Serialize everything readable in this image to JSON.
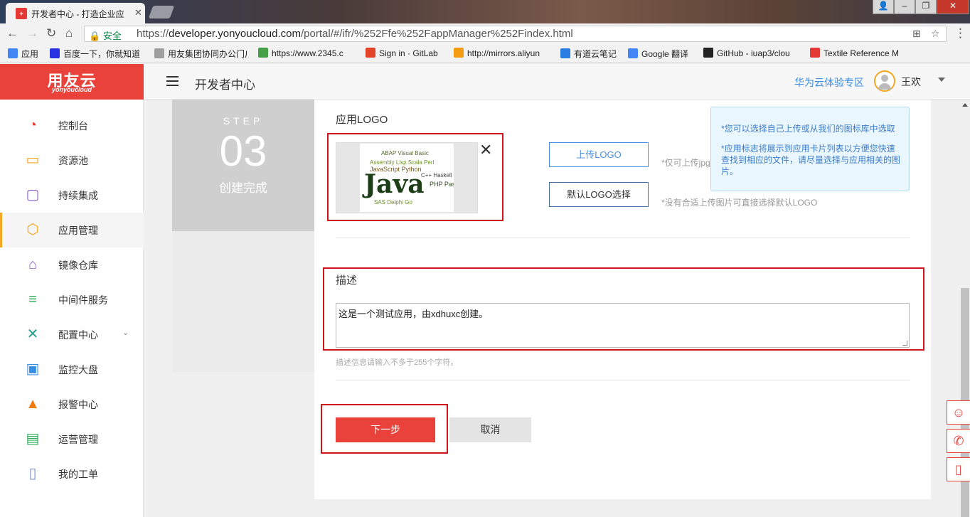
{
  "browser": {
    "tab_title": "开发者中心 - 打造企业应",
    "tab_favicon": "yonyou-favicon",
    "secure_label": "安全",
    "url_prefix": "https://",
    "url_host": "developer.yonyoucloud.com",
    "url_path": "/portal/#/ifr/%252Ffe%252FappManager%252Findex.html",
    "bookmarks": [
      {
        "label": "应用",
        "icon": "apps-grid-icon",
        "color": "#4285f4"
      },
      {
        "label": "百度一下，你就知道",
        "icon": "baidu-paw-icon",
        "color": "#2932e1"
      },
      {
        "label": "用友集团协同办公门户",
        "icon": "page-icon",
        "color": "#9e9e9e"
      },
      {
        "label": "https://www.2345.c",
        "icon": "2345-icon",
        "color": "#43a047"
      },
      {
        "label": "Sign in · GitLab",
        "icon": "gitlab-icon",
        "color": "#e24329"
      },
      {
        "label": "http://mirrors.aliyun",
        "icon": "aliyun-icon",
        "color": "#f39c12"
      },
      {
        "label": "有道云笔记",
        "icon": "youdao-note-icon",
        "color": "#2a7de1"
      },
      {
        "label": "Google 翻译",
        "icon": "google-translate-icon",
        "color": "#4285f4"
      },
      {
        "label": "GitHub - iuap3/clou",
        "icon": "github-icon",
        "color": "#222222"
      },
      {
        "label": "Textile Reference M",
        "icon": "textile-icon",
        "color": "#e53935"
      }
    ]
  },
  "header": {
    "logo_main": "用友云",
    "logo_sub": "yonyoucloud",
    "title": "开发者中心",
    "zone_link": "华为云体验专区",
    "user_name": "王欢"
  },
  "sidebar": {
    "items": [
      {
        "label": "控制台",
        "icon": "dashboard-icon",
        "color": "#e8423a"
      },
      {
        "label": "资源池",
        "icon": "inbox-icon",
        "color": "#f5a623"
      },
      {
        "label": "持续集成",
        "icon": "integration-icon",
        "color": "#8e5cc7"
      },
      {
        "label": "应用管理",
        "icon": "cubes-icon",
        "color": "#f5a623"
      },
      {
        "label": "镜像仓库",
        "icon": "warehouse-icon",
        "color": "#8e5cc7"
      },
      {
        "label": "中间件服务",
        "icon": "database-icon",
        "color": "#2eab5a"
      },
      {
        "label": "配置中心",
        "icon": "tools-icon",
        "color": "#2a9d8f"
      },
      {
        "label": "监控大盘",
        "icon": "monitor-icon",
        "color": "#3a8ee6"
      },
      {
        "label": "报警中心",
        "icon": "bell-icon",
        "color": "#f07b10"
      },
      {
        "label": "运营管理",
        "icon": "chart-board-icon",
        "color": "#2eab5a"
      },
      {
        "label": "我的工单",
        "icon": "document-icon",
        "color": "#7a8fd6"
      }
    ],
    "active_index": 3
  },
  "step": {
    "label": "STEP",
    "number": "03",
    "name": "创建完成"
  },
  "form": {
    "logo_label": "应用LOGO",
    "upload_button": "上传LOGO",
    "upload_hint": "*仅可上传jpg",
    "default_logo_button": "默认LOGO选择",
    "default_hint": "*没有合适上传图片可直接选择默认LOGO",
    "tips": [
      "*您可以选择自己上传或从我们的图标库中选取",
      "*应用标志将展示到应用卡片列表以方便您快速查找到相应的文件，请尽量选择与应用相关的图片。"
    ],
    "description_label": "描述",
    "description_value": "这是一个测试应用，由xdhuxc创建。",
    "description_hint": "描述信息请输入不多于255个字符。",
    "next_button": "下一步",
    "cancel_button": "取消"
  },
  "colors": {
    "brand": "#e8423a",
    "link": "#3a8ee6",
    "highlight_box": "#d0141c"
  }
}
